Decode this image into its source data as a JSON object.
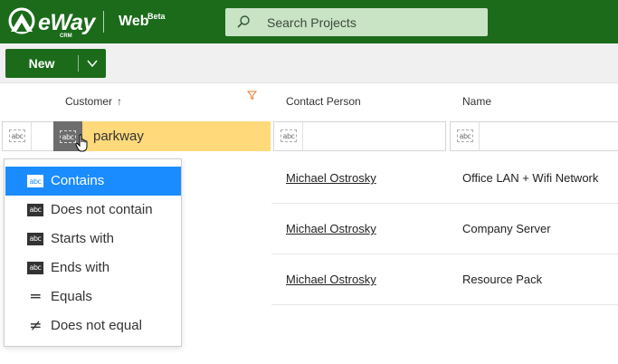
{
  "header": {
    "logo_text": "eWay",
    "logo_sub": "CRM",
    "app_name": "Web",
    "app_sup": "Beta",
    "search_placeholder": "Search Projects"
  },
  "toolbar": {
    "new_label": "New"
  },
  "columns": [
    {
      "label": "Customer"
    },
    {
      "label": "Contact Person"
    },
    {
      "label": "Name"
    }
  ],
  "filter": {
    "customer_value": "parkway",
    "badge": "abc"
  },
  "rows": [
    {
      "contact": "Michael Ostrosky",
      "name": "Office LAN + Wifi Network"
    },
    {
      "contact": "Michael Ostrosky",
      "name": "Company Server"
    },
    {
      "contact": "Michael Ostrosky",
      "name": "Resource Pack"
    }
  ],
  "dropdown": {
    "selected_index": 0,
    "options": [
      {
        "label": "Contains",
        "icon": "abc-dotted-icon"
      },
      {
        "label": "Does not contain",
        "icon": "abc-inverted-icon"
      },
      {
        "label": "Starts with",
        "icon": "abc-start-icon"
      },
      {
        "label": "Ends with",
        "icon": "abc-end-icon"
      },
      {
        "label": "Equals",
        "icon": "equals-icon"
      },
      {
        "label": "Does not equal",
        "icon": "not-equal-icon"
      }
    ]
  },
  "colors": {
    "brand_green": "#1b6b1b",
    "search_bg": "#c9e3c5",
    "filter_highlight": "#ffd97a",
    "selection_blue": "#1a8cff"
  }
}
